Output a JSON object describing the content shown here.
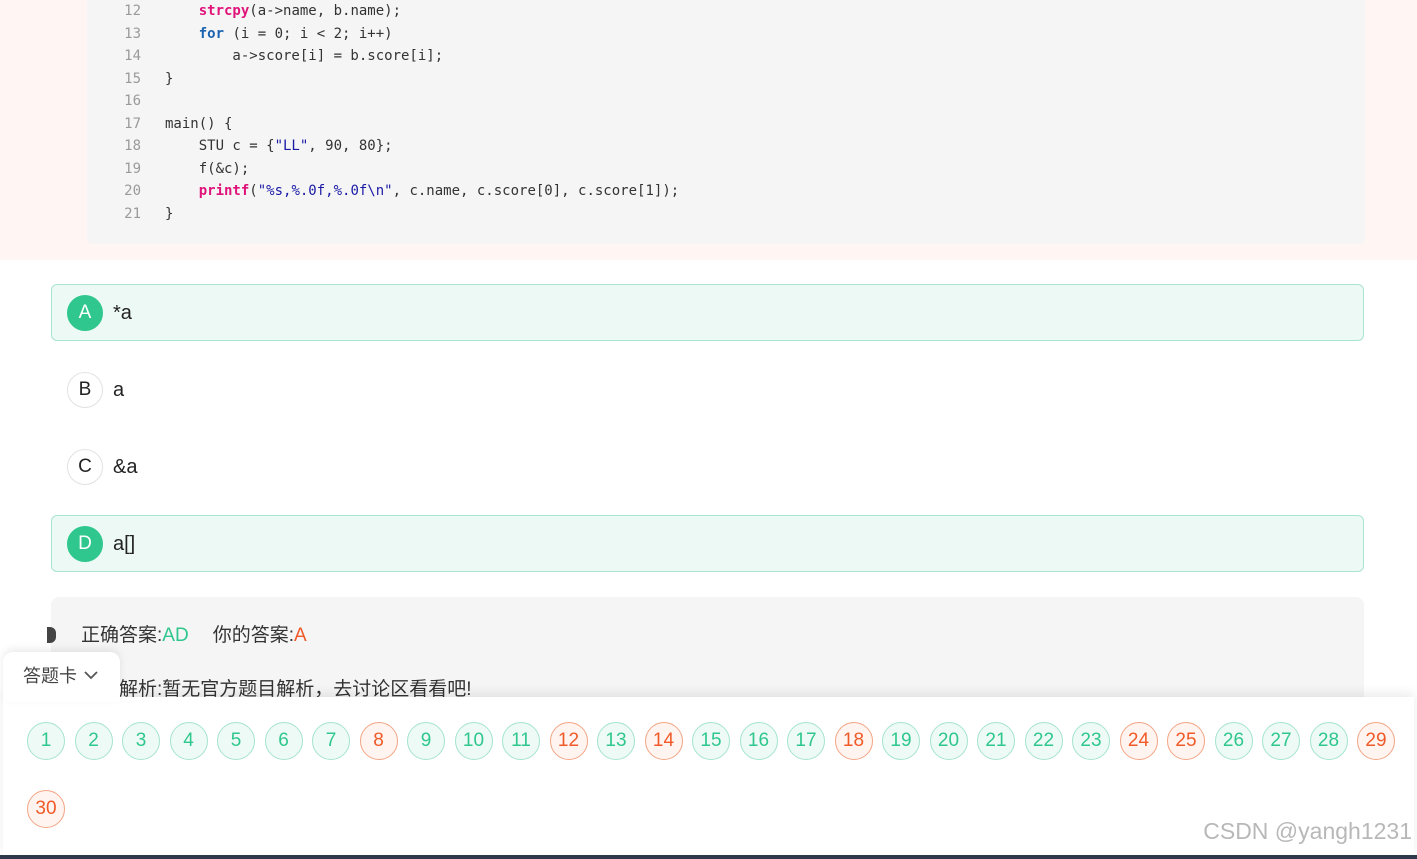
{
  "code_lines": [
    {
      "n": "12",
      "text": "    strcpy(a->name, b.name);"
    },
    {
      "n": "13",
      "text": "    for (i = 0; i < 2; i++)"
    },
    {
      "n": "14",
      "text": "        a->score[i] = b.score[i];"
    },
    {
      "n": "15",
      "text": "}"
    },
    {
      "n": "16",
      "text": ""
    },
    {
      "n": "17",
      "text": "main() {"
    },
    {
      "n": "18",
      "text": "    STU c = {\"LL\", 90, 80};"
    },
    {
      "n": "19",
      "text": "    f(&c);"
    },
    {
      "n": "20",
      "text": "    printf(\"%s,%.0f,%.0f\\n\", c.name, c.score[0], c.score[1]);"
    },
    {
      "n": "21",
      "text": "}"
    }
  ],
  "options": [
    {
      "letter": "A",
      "text": "*a",
      "selected": true
    },
    {
      "letter": "B",
      "text": "a",
      "selected": false
    },
    {
      "letter": "C",
      "text": "&a",
      "selected": false
    },
    {
      "letter": "D",
      "text": "a[]",
      "selected": true
    }
  ],
  "answer": {
    "correct_label": "正确答案:",
    "correct_value": "AD",
    "your_label": "你的答案:",
    "your_value": "A",
    "analysis_text": "解析:暂无官方题目解析，去讨论区看看吧!"
  },
  "answer_card": {
    "tab_label": "答题卡",
    "numbers": [
      {
        "n": "1",
        "state": "ok"
      },
      {
        "n": "2",
        "state": "ok"
      },
      {
        "n": "3",
        "state": "ok"
      },
      {
        "n": "4",
        "state": "ok"
      },
      {
        "n": "5",
        "state": "ok"
      },
      {
        "n": "6",
        "state": "ok"
      },
      {
        "n": "7",
        "state": "ok"
      },
      {
        "n": "8",
        "state": "bad"
      },
      {
        "n": "9",
        "state": "ok"
      },
      {
        "n": "10",
        "state": "ok"
      },
      {
        "n": "11",
        "state": "ok"
      },
      {
        "n": "12",
        "state": "bad"
      },
      {
        "n": "13",
        "state": "ok"
      },
      {
        "n": "14",
        "state": "bad"
      },
      {
        "n": "15",
        "state": "ok"
      },
      {
        "n": "16",
        "state": "ok"
      },
      {
        "n": "17",
        "state": "ok"
      },
      {
        "n": "18",
        "state": "bad"
      },
      {
        "n": "19",
        "state": "ok"
      },
      {
        "n": "20",
        "state": "ok"
      },
      {
        "n": "21",
        "state": "ok"
      },
      {
        "n": "22",
        "state": "ok"
      },
      {
        "n": "23",
        "state": "ok"
      },
      {
        "n": "24",
        "state": "bad"
      },
      {
        "n": "25",
        "state": "bad"
      },
      {
        "n": "26",
        "state": "ok"
      },
      {
        "n": "27",
        "state": "ok"
      },
      {
        "n": "28",
        "state": "ok"
      },
      {
        "n": "29",
        "state": "bad"
      },
      {
        "n": "30",
        "state": "bad"
      }
    ]
  },
  "watermark": "CSDN @yangh1231",
  "colors": {
    "correct": "#2fc78e",
    "wrong": "#f05a28"
  },
  "icons": {
    "tab_toggle": "chevron-down-icon"
  }
}
